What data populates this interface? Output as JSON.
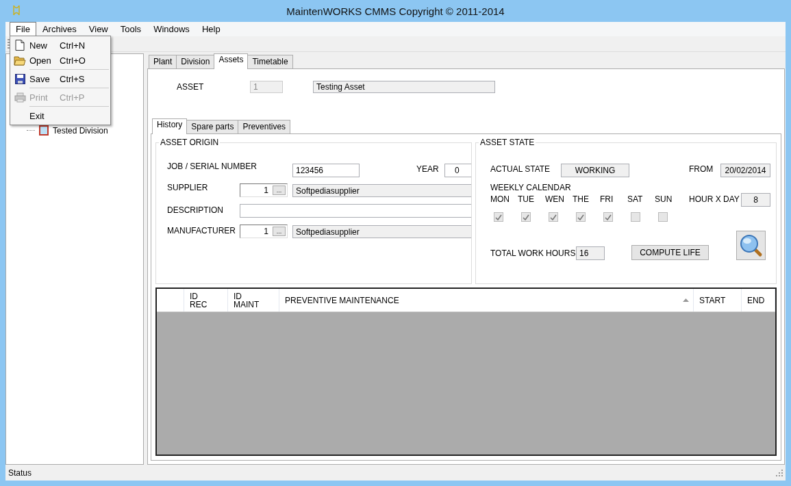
{
  "window": {
    "title": "MaintenWORKS CMMS Copyright © 2011-2014"
  },
  "menu": [
    {
      "label": "File",
      "open": true
    },
    {
      "label": "Archives",
      "open": false
    },
    {
      "label": "View",
      "open": false
    },
    {
      "label": "Tools",
      "open": false
    },
    {
      "label": "Windows",
      "open": false
    },
    {
      "label": "Help",
      "open": false
    }
  ],
  "file_menu": [
    {
      "kind": "item",
      "label": "New",
      "shortcut": "Ctrl+N",
      "disabled": false
    },
    {
      "kind": "item",
      "label": "Open",
      "shortcut": "Ctrl+O",
      "disabled": false
    },
    {
      "kind": "separator"
    },
    {
      "kind": "item",
      "label": "Save",
      "shortcut": "Ctrl+S",
      "disabled": false
    },
    {
      "kind": "separator"
    },
    {
      "kind": "item",
      "label": "Print",
      "shortcut": "Ctrl+P",
      "disabled": true
    },
    {
      "kind": "separator"
    },
    {
      "kind": "item",
      "label": "Exit",
      "disabled": false
    }
  ],
  "tree": {
    "items": [
      {
        "label": "Tested Division"
      }
    ]
  },
  "tabs": [
    {
      "label": "Plant",
      "selected": false
    },
    {
      "label": "Division",
      "selected": false
    },
    {
      "label": "Assets",
      "selected": true
    },
    {
      "label": "Timetable",
      "selected": false
    }
  ],
  "asset": {
    "label": "ASSET",
    "id": "1",
    "name": "Testing Asset"
  },
  "subtabs": [
    {
      "label": "History",
      "selected": true
    },
    {
      "label": "Spare parts",
      "selected": false
    },
    {
      "label": "Preventives",
      "selected": false
    }
  ],
  "asset_origin": {
    "title": "ASSET ORIGIN",
    "job_label": "JOB / SERIAL NUMBER",
    "job_value": "123456",
    "year_label": "YEAR",
    "year_value": "0",
    "supplier_label": "SUPPLIER",
    "supplier_id": "1",
    "supplier_button": "...",
    "supplier_name": "Softpediasupplier",
    "description_label": "DESCRIPTION",
    "manufacturer_label": "MANUFACTURER",
    "manufacturer_id": "1",
    "manufacturer_button": "...",
    "manufacturer_name": "Softpediasupplier"
  },
  "asset_state": {
    "title": "ASSET STATE",
    "actual_label": "ACTUAL STATE",
    "actual_value": "WORKING",
    "from_label": "FROM",
    "from_value": "20/02/2014",
    "calendar_label": "WEEKLY CALENDAR",
    "days": [
      {
        "label": "MON",
        "checked": true
      },
      {
        "label": "TUE",
        "checked": true
      },
      {
        "label": "WEN",
        "checked": true
      },
      {
        "label": "THE",
        "checked": true
      },
      {
        "label": "FRI",
        "checked": true
      },
      {
        "label": "SAT",
        "checked": false
      },
      {
        "label": "SUN",
        "checked": false
      }
    ],
    "hours_label": "HOUR X DAY",
    "hours_value": "8",
    "total_label": "TOTAL WORK HOURS",
    "total_value": "16",
    "compute_button": "COMPUTE LIFE"
  },
  "grid": {
    "columns": [
      {
        "label": "ID\nREC"
      },
      {
        "label": "ID\nMAINT"
      },
      {
        "label": "PREVENTIVE MAINTENANCE",
        "sorted": true
      },
      {
        "label": "START"
      },
      {
        "label": "END"
      }
    ]
  },
  "status_bar": {
    "text": "Status"
  }
}
